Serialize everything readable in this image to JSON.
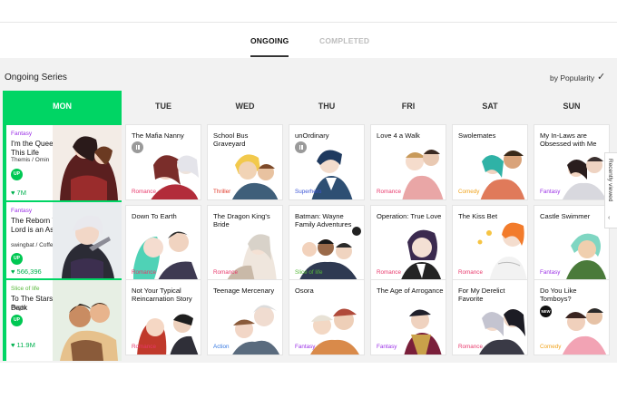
{
  "tabs": {
    "ongoing": "ONGOING",
    "completed": "COMPLETED"
  },
  "section": {
    "title": "Ongoing Series",
    "sort_label": "by Popularity",
    "sort_check": "✓"
  },
  "side_tab": {
    "label": "Recently viewed",
    "chevron": "‹"
  },
  "days": [
    "MON",
    "TUE",
    "WED",
    "THU",
    "FRI",
    "SAT",
    "SUN"
  ],
  "colors": {
    "accent_green": "#00d564",
    "fantasy": "#9b30e6",
    "romance": "#e8386b",
    "thriller": "#e03a2a",
    "superhero": "#3d56d6",
    "comedy": "#f0a21a",
    "slice_of_life": "#57b93a",
    "action": "#3477e0"
  },
  "monday": [
    {
      "genre": "Fantasy",
      "genre_color": "#9b30e6",
      "title": "I'm the Queen in This Life",
      "author": "Themis / Omin",
      "badge": "UP",
      "likes": "7M"
    },
    {
      "genre": "Fantasy",
      "genre_color": "#9b30e6",
      "title": "The Reborn Young Lord is an Assassin",
      "author": "swingbat / CoffeeLime",
      "badge": "UP",
      "likes": "566,396"
    },
    {
      "genre": "Slice of life",
      "genre_color": "#57b93a",
      "title": "To The Stars and Back",
      "author": "Peglo",
      "badge": "UP",
      "likes": "11.9M"
    }
  ],
  "grid": [
    [
      {
        "title": "The Mafia Nanny",
        "genre": "Romance",
        "genre_color": "#e8386b",
        "status": "pause"
      },
      {
        "title": "Down To Earth",
        "genre": "Romance",
        "genre_color": "#e8386b"
      },
      {
        "title": "Not Your Typical Reincarnation Story",
        "genre": "Romance",
        "genre_color": "#e8386b"
      }
    ],
    [
      {
        "title": "School Bus Graveyard",
        "genre": "Thriller",
        "genre_color": "#e03a2a"
      },
      {
        "title": "The Dragon King's Bride",
        "genre": "Romance",
        "genre_color": "#e8386b"
      },
      {
        "title": "Teenage Mercenary",
        "genre": "Action",
        "genre_color": "#3477e0"
      }
    ],
    [
      {
        "title": "unOrdinary",
        "genre": "Superhero",
        "genre_color": "#3d56d6",
        "status": "pause"
      },
      {
        "title": "Batman: Wayne Family Adventures",
        "genre": "Slice of life",
        "genre_color": "#57b93a"
      },
      {
        "title": "Osora",
        "genre": "Fantasy",
        "genre_color": "#9b30e6"
      }
    ],
    [
      {
        "title": "Love 4 a Walk",
        "genre": "Romance",
        "genre_color": "#e8386b"
      },
      {
        "title": "Operation: True Love",
        "genre": "Romance",
        "genre_color": "#e8386b"
      },
      {
        "title": "The Age of Arrogance",
        "genre": "Fantasy",
        "genre_color": "#9b30e6"
      }
    ],
    [
      {
        "title": "Swolemates",
        "genre": "Comedy",
        "genre_color": "#f0a21a"
      },
      {
        "title": "The Kiss Bet",
        "genre": "Romance",
        "genre_color": "#e8386b"
      },
      {
        "title": "For My Derelict Favorite",
        "genre": "Romance",
        "genre_color": "#e8386b"
      }
    ],
    [
      {
        "title": "My In-Laws are Obsessed with Me",
        "genre": "Fantasy",
        "genre_color": "#9b30e6"
      },
      {
        "title": "Castle Swimmer",
        "genre": "Fantasy",
        "genre_color": "#9b30e6"
      },
      {
        "title": "Do You Like Tomboys?",
        "genre": "Comedy",
        "genre_color": "#f0a21a",
        "status": "NEW"
      }
    ]
  ]
}
